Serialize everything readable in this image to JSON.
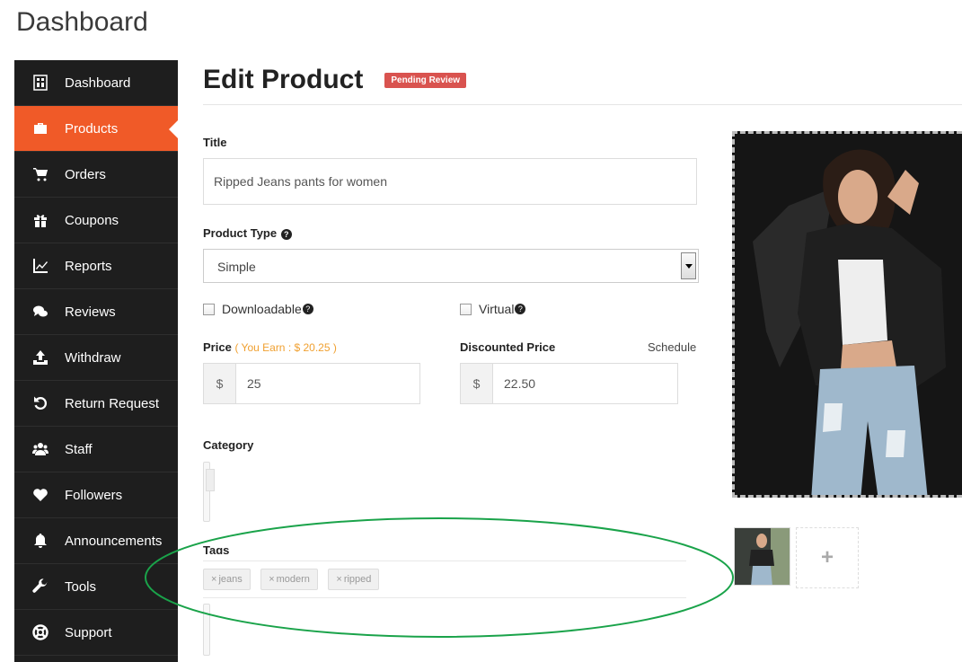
{
  "page": {
    "heading": "Dashboard"
  },
  "sidebar": {
    "items": [
      {
        "label": "Dashboard",
        "icon": "dashboard-icon"
      },
      {
        "label": "Products",
        "icon": "briefcase-icon",
        "active": true
      },
      {
        "label": "Orders",
        "icon": "cart-icon"
      },
      {
        "label": "Coupons",
        "icon": "gift-icon"
      },
      {
        "label": "Reports",
        "icon": "chart-line-icon"
      },
      {
        "label": "Reviews",
        "icon": "comments-icon"
      },
      {
        "label": "Withdraw",
        "icon": "upload-icon"
      },
      {
        "label": "Return Request",
        "icon": "undo-icon"
      },
      {
        "label": "Staff",
        "icon": "users-icon"
      },
      {
        "label": "Followers",
        "icon": "heart-icon"
      },
      {
        "label": "Announcements",
        "icon": "bell-icon"
      },
      {
        "label": "Tools",
        "icon": "wrench-icon"
      },
      {
        "label": "Support",
        "icon": "lifebuoy-icon"
      }
    ]
  },
  "main": {
    "title": "Edit Product",
    "status": "Pending Review",
    "title_label": "Title",
    "title_value": "Ripped Jeans pants for women",
    "product_type_label": "Product Type",
    "product_type_value": "Simple",
    "downloadable_label": "Downloadable",
    "virtual_label": "Virtual",
    "price_label": "Price",
    "price_earn": "( You Earn : $ 20.25 )",
    "price_currency": "$",
    "price_value": "25",
    "discount_label": "Discounted Price",
    "schedule_label": "Schedule",
    "discount_currency": "$",
    "discount_value": "22.50",
    "category_label": "Category",
    "tags_label": "Tags",
    "tags": [
      "jeans",
      "modern",
      "ripped"
    ],
    "tag_remove_symbol": "×",
    "add_image_symbol": "+"
  },
  "colors": {
    "accent": "#f05a28",
    "sidebar_bg": "#1e1e1e",
    "badge": "#d9534f",
    "highlight": "#1aa34a"
  }
}
